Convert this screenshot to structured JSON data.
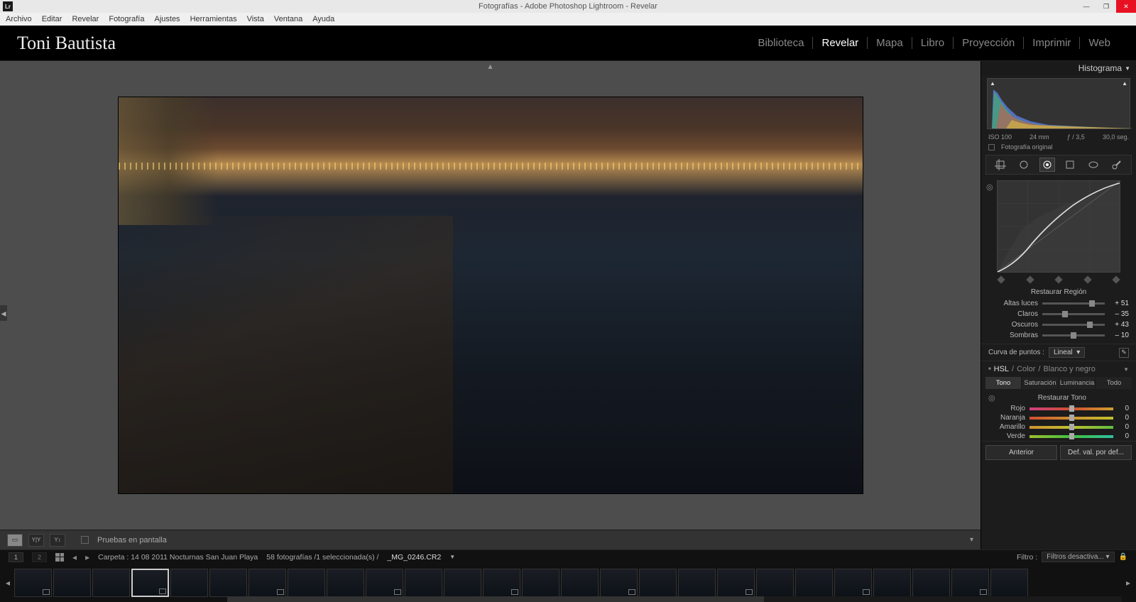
{
  "window": {
    "title": "Fotografías - Adobe Photoshop Lightroom - Revelar",
    "icon_text": "Lr"
  },
  "menubar": [
    "Archivo",
    "Editar",
    "Revelar",
    "Fotografía",
    "Ajustes",
    "Herramientas",
    "Vista",
    "Ventana",
    "Ayuda"
  ],
  "identity": "Toni Bautista",
  "modules": [
    {
      "label": "Biblioteca",
      "active": false
    },
    {
      "label": "Revelar",
      "active": true
    },
    {
      "label": "Mapa",
      "active": false
    },
    {
      "label": "Libro",
      "active": false
    },
    {
      "label": "Proyección",
      "active": false
    },
    {
      "label": "Imprimir",
      "active": false
    },
    {
      "label": "Web",
      "active": false
    }
  ],
  "toolbar": {
    "proof_label": "Pruebas en pantalla"
  },
  "right": {
    "histogram": {
      "title": "Histograma",
      "iso": "ISO 100",
      "focal": "24 mm",
      "aperture": "ƒ / 3,5",
      "shutter": "30,0 seg.",
      "original": "Fotografía original"
    },
    "tone_curve": {
      "restore": "Restaurar Región",
      "rows": [
        {
          "label": "Altas luces",
          "value": "+ 51",
          "pos": 75
        },
        {
          "label": "Claros",
          "value": "– 35",
          "pos": 32
        },
        {
          "label": "Oscuros",
          "value": "+ 43",
          "pos": 72
        },
        {
          "label": "Sombras",
          "value": "– 10",
          "pos": 45
        }
      ],
      "points_label": "Curva de puntos :",
      "points_value": "Lineal"
    },
    "hsl": {
      "header_hsl": "HSL",
      "header_color": "Color",
      "header_bw": "Blanco y negro",
      "tabs": [
        {
          "label": "Tono",
          "active": true
        },
        {
          "label": "Saturación",
          "active": false
        },
        {
          "label": "Luminancia",
          "active": false
        },
        {
          "label": "Todo",
          "active": false
        }
      ],
      "restore": "Restaurar Tono",
      "rows": [
        {
          "label": "Rojo",
          "value": "0",
          "grad": "linear-gradient(90deg,#d04080,#d05030,#d0a030)"
        },
        {
          "label": "Naranja",
          "value": "0",
          "grad": "linear-gradient(90deg,#d05030,#d09030,#c0c030)"
        },
        {
          "label": "Amarillo",
          "value": "0",
          "grad": "linear-gradient(90deg,#d09030,#c0c030,#60c040)"
        },
        {
          "label": "Verde",
          "value": "0",
          "grad": "linear-gradient(90deg,#a0c030,#40c040,#30c0a0)"
        }
      ]
    },
    "buttons": {
      "prev": "Anterior",
      "reset": "Def. val. por def..."
    }
  },
  "info": {
    "folder_prefix": "Carpeta :",
    "folder": "14 08 2011 Nocturnas San Juan Playa",
    "count": "58 fotografías /1 seleccionada(s) /",
    "filename": "_MG_0246.CR2",
    "filter_label": "Filtro :",
    "filter_value": "Filtros desactiva..."
  },
  "thumb_count": 26
}
